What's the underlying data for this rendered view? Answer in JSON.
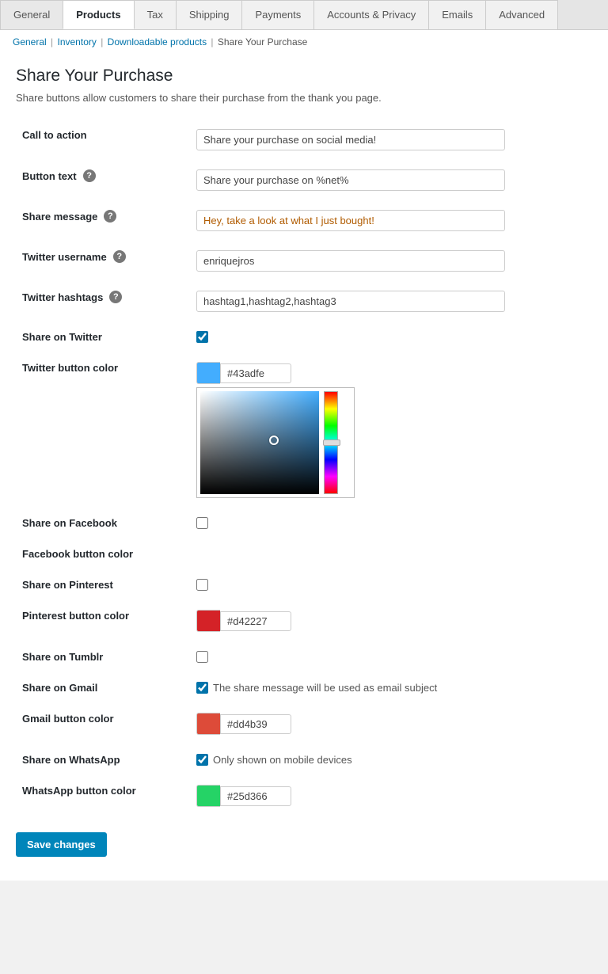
{
  "tabs": [
    {
      "id": "general",
      "label": "General",
      "active": false
    },
    {
      "id": "products",
      "label": "Products",
      "active": true
    },
    {
      "id": "tax",
      "label": "Tax",
      "active": false
    },
    {
      "id": "shipping",
      "label": "Shipping",
      "active": false
    },
    {
      "id": "payments",
      "label": "Payments",
      "active": false
    },
    {
      "id": "accounts-privacy",
      "label": "Accounts & Privacy",
      "active": false
    },
    {
      "id": "emails",
      "label": "Emails",
      "active": false
    },
    {
      "id": "advanced",
      "label": "Advanced",
      "active": false
    }
  ],
  "breadcrumb": {
    "items": [
      {
        "label": "General",
        "href": "#"
      },
      {
        "label": "Inventory",
        "href": "#"
      },
      {
        "label": "Downloadable products",
        "href": "#"
      },
      {
        "label": "Share Your Purchase",
        "href": null
      }
    ]
  },
  "page": {
    "title": "Share Your Purchase",
    "description": "Share buttons allow customers to share their purchase from the thank you page."
  },
  "form": {
    "call_to_action_label": "Call to action",
    "call_to_action_value": "Share your purchase on social media!",
    "call_to_action_placeholder": "Share your purchase on social media!",
    "button_text_label": "Button text",
    "button_text_value": "Share your purchase on %net%",
    "button_text_placeholder": "Share your purchase on %net%",
    "share_message_label": "Share message",
    "share_message_value": "Hey, take a look at what I just bought!",
    "share_message_placeholder": "Hey, take a look at what I just bought!",
    "twitter_username_label": "Twitter username",
    "twitter_username_value": "enriquejros",
    "twitter_username_placeholder": "enriquejros",
    "twitter_hashtags_label": "Twitter hashtags",
    "twitter_hashtags_value": "hashtag1,hashtag2,hashtag3",
    "twitter_hashtags_placeholder": "hashtag1,hashtag2,hashtag3",
    "share_twitter_label": "Share on Twitter",
    "share_twitter_checked": true,
    "twitter_button_color_label": "Twitter button color",
    "twitter_button_color_hex": "#43adfe",
    "twitter_button_color_swatch": "#43adfe",
    "share_facebook_label": "Share on Facebook",
    "facebook_button_color_label": "Facebook button color",
    "share_pinterest_label": "Share on Pinterest",
    "pinterest_button_color_label": "Pinterest button color",
    "pinterest_button_color_hex": "#d42227",
    "pinterest_button_color_swatch": "#d42227",
    "share_tumblr_label": "Share on Tumblr",
    "share_tumblr_checked": false,
    "share_gmail_label": "Share on Gmail",
    "share_gmail_checked": true,
    "share_gmail_note": "The share message will be used as email subject",
    "gmail_button_color_label": "Gmail button color",
    "gmail_button_color_hex": "#dd4b39",
    "gmail_button_color_swatch": "#dd4b39",
    "share_whatsapp_label": "Share on WhatsApp",
    "share_whatsapp_checked": true,
    "share_whatsapp_note": "Only shown on mobile devices",
    "whatsapp_button_color_label": "WhatsApp button color",
    "whatsapp_button_color_hex": "#25d366",
    "whatsapp_button_color_swatch": "#25d366",
    "save_label": "Save changes"
  }
}
